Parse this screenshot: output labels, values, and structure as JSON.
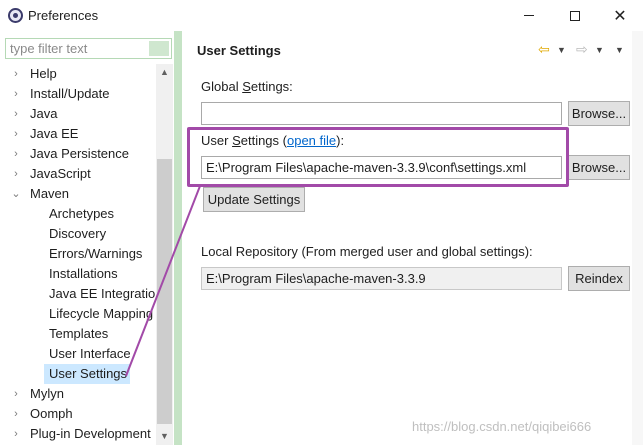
{
  "window": {
    "title": "Preferences",
    "minimize": "—",
    "maximize": "☐",
    "close": "✕"
  },
  "filter": {
    "placeholder": "type filter text",
    "value": ""
  },
  "tree": {
    "items": [
      {
        "label": "Help",
        "level": 0,
        "chevron": "›",
        "selected": false
      },
      {
        "label": "Install/Update",
        "level": 0,
        "chevron": "›",
        "selected": false
      },
      {
        "label": "Java",
        "level": 0,
        "chevron": "›",
        "selected": false
      },
      {
        "label": "Java EE",
        "level": 0,
        "chevron": "›",
        "selected": false
      },
      {
        "label": "Java Persistence",
        "level": 0,
        "chevron": "›",
        "selected": false
      },
      {
        "label": "JavaScript",
        "level": 0,
        "chevron": "›",
        "selected": false
      },
      {
        "label": "Maven",
        "level": 0,
        "chevron": "⌄",
        "selected": false
      },
      {
        "label": "Archetypes",
        "level": 1,
        "chevron": "",
        "selected": false
      },
      {
        "label": "Discovery",
        "level": 1,
        "chevron": "",
        "selected": false
      },
      {
        "label": "Errors/Warnings",
        "level": 1,
        "chevron": "",
        "selected": false
      },
      {
        "label": "Installations",
        "level": 1,
        "chevron": "",
        "selected": false
      },
      {
        "label": "Java EE Integratio",
        "level": 1,
        "chevron": "",
        "selected": false
      },
      {
        "label": "Lifecycle Mapping",
        "level": 1,
        "chevron": "",
        "selected": false
      },
      {
        "label": "Templates",
        "level": 1,
        "chevron": "",
        "selected": false
      },
      {
        "label": "User Interface",
        "level": 1,
        "chevron": "",
        "selected": false
      },
      {
        "label": "User Settings",
        "level": 1,
        "chevron": "",
        "selected": true
      },
      {
        "label": "Mylyn",
        "level": 0,
        "chevron": "›",
        "selected": false
      },
      {
        "label": "Oomph",
        "level": 0,
        "chevron": "›",
        "selected": false
      },
      {
        "label": "Plug-in Development",
        "level": 0,
        "chevron": "›",
        "selected": false
      }
    ]
  },
  "page": {
    "title": "User Settings",
    "global_settings": {
      "label_prefix": "Global ",
      "label_mnemonic": "S",
      "label_suffix": "ettings:",
      "value": "",
      "browse_label": "Browse..."
    },
    "user_settings": {
      "label_prefix": "User ",
      "label_mnemonic": "S",
      "label_mid": "ettings (",
      "link_text": "open file",
      "label_end": "):",
      "value": "E:\\Program Files\\apache-maven-3.3.9\\conf\\settings.xml",
      "browse_label": "Browse..."
    },
    "update_button": "Update Settings",
    "local_repo": {
      "label": "Local Repository (From merged user and global settings):",
      "value": "E:\\Program Files\\apache-maven-3.3.9",
      "reindex_label": "Reindex"
    }
  },
  "nav": {
    "back_icon": "⇦",
    "forward_icon": "⇨",
    "dropdown_icon": "▼",
    "menu_icon": "▼"
  },
  "annotation": {
    "color": "#a24aa8"
  },
  "watermark": "https://blog.csdn.net/qiqibei666"
}
